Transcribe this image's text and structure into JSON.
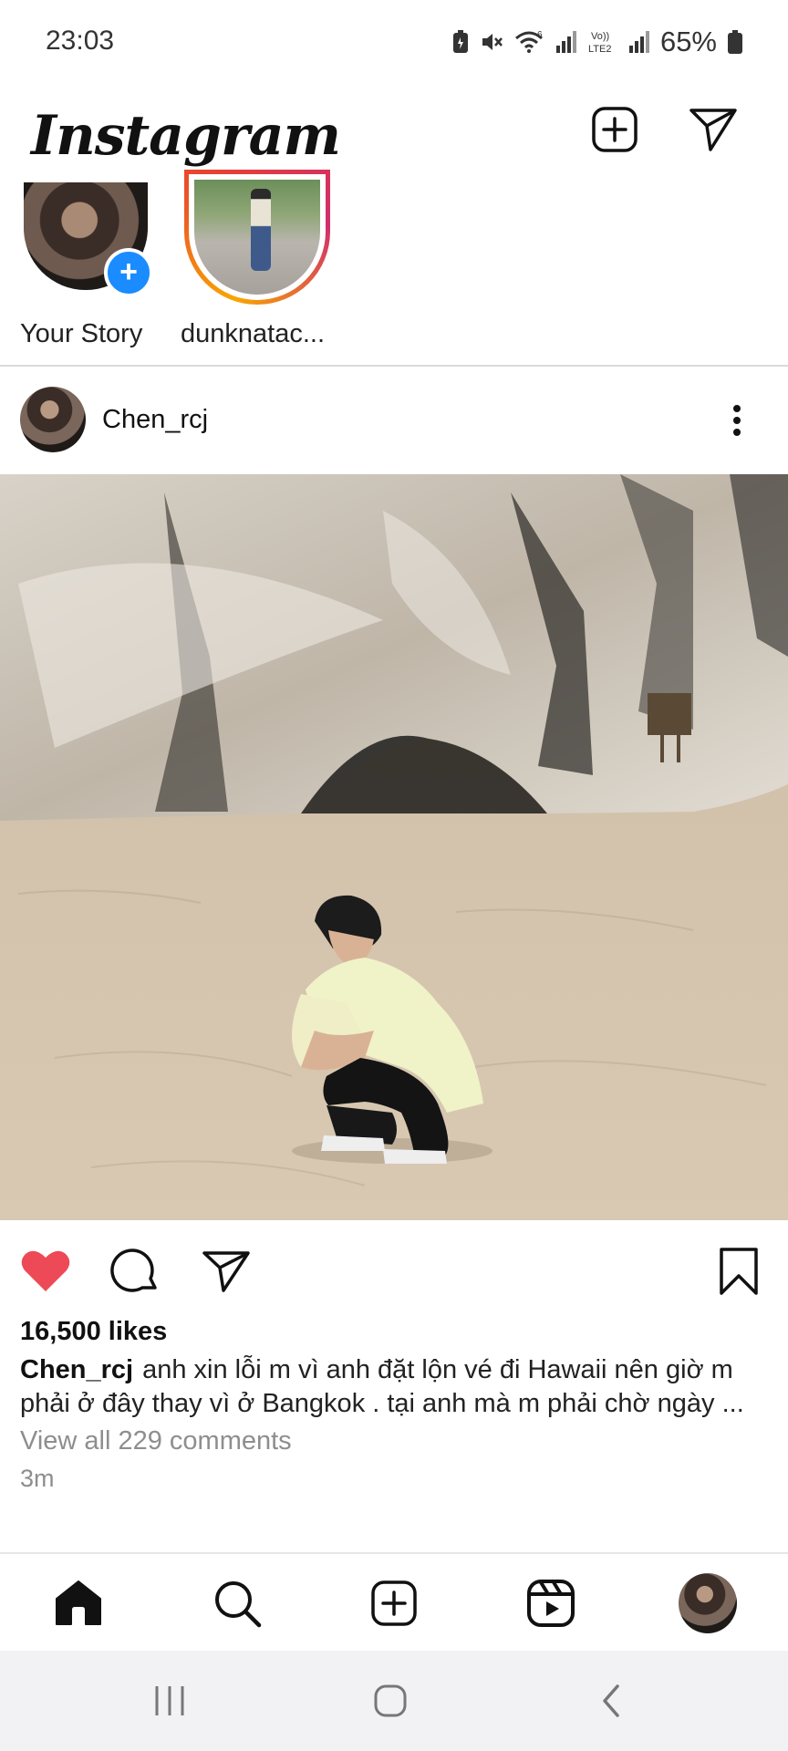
{
  "status_bar": {
    "time": "23:03",
    "battery_percent": "65%",
    "wifi_label": "6",
    "volte_label_1": "Vo))",
    "volte_label_2": "LTE2",
    "icons": [
      "battery-saver-icon",
      "mute-icon",
      "wifi-icon",
      "signal-icon",
      "volte-icon",
      "signal-icon",
      "battery-icon"
    ]
  },
  "header": {
    "logo": "Instagram",
    "icons": [
      "new-post-icon",
      "direct-message-icon"
    ]
  },
  "stories": [
    {
      "label": "Your Story",
      "has_add": true,
      "ring": false
    },
    {
      "label": "dunknatac...",
      "has_add": false,
      "ring": true
    }
  ],
  "post": {
    "username": "Chen_rcj",
    "likes": "16,500 likes",
    "caption_user": "Chen_rcj",
    "caption_text": "anh xin lỗi m vì anh đặt lộn vé đi Hawaii nên giờ m phải ở đây thay vì ở Bangkok . tại anh mà m phải chờ ngày ...",
    "view_comments": "View all 229 comments",
    "time": "3m",
    "liked": true,
    "like_color": "#ed4956"
  },
  "bottom_nav": {
    "items": [
      "home-icon",
      "search-icon",
      "create-icon",
      "reels-icon",
      "profile-avatar"
    ]
  },
  "system_nav": {
    "items": [
      "recents-icon",
      "home-circle-icon",
      "back-icon"
    ]
  }
}
